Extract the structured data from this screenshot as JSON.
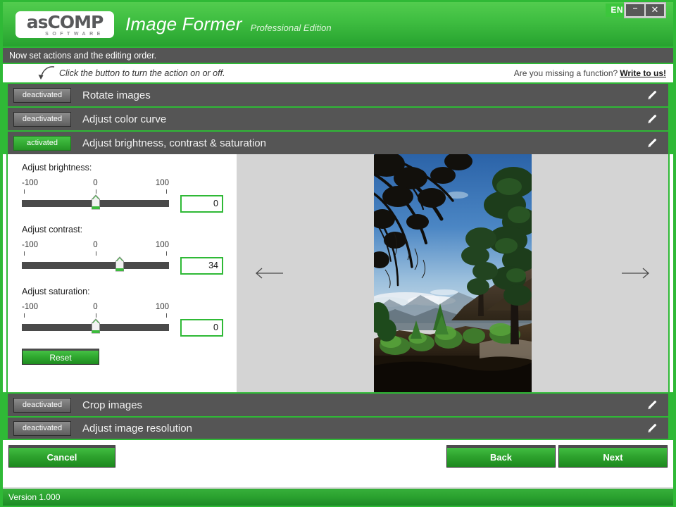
{
  "window": {
    "language_badge": "EN",
    "minimize_label": "–",
    "close_label": "✕"
  },
  "header": {
    "logo_main": "asCOMP",
    "logo_sub": "SOFTWARE",
    "app_title": "Image Former",
    "edition": "Professional Edition"
  },
  "subheader": {
    "text": "Now set actions and the editing order."
  },
  "hint": {
    "text": "Click the button to turn the action on or off.",
    "right_question": "Are you missing a function?",
    "right_link": "Write to us!"
  },
  "actions": [
    {
      "state_label": "deactivated",
      "state": "off",
      "label": "Rotate images"
    },
    {
      "state_label": "deactivated",
      "state": "off",
      "label": "Adjust color curve"
    },
    {
      "state_label": "activated",
      "state": "on",
      "label": "Adjust brightness, contrast & saturation"
    },
    {
      "state_label": "deactivated",
      "state": "off",
      "label": "Crop images"
    },
    {
      "state_label": "deactivated",
      "state": "off",
      "label": "Adjust image resolution"
    }
  ],
  "panel": {
    "sliders": [
      {
        "label": "Adjust brightness:",
        "scale_min": "-100",
        "scale_mid": "0",
        "scale_max": "100",
        "value": "0",
        "value_number": 0
      },
      {
        "label": "Adjust contrast:",
        "scale_min": "-100",
        "scale_mid": "0",
        "scale_max": "100",
        "value": "34",
        "value_number": 34
      },
      {
        "label": "Adjust saturation:",
        "scale_min": "-100",
        "scale_mid": "0",
        "scale_max": "100",
        "value": "0",
        "value_number": 0
      }
    ],
    "reset_label": "Reset",
    "prev_icon": "arrow-left-icon",
    "next_icon": "arrow-right-icon"
  },
  "buttons": {
    "cancel": "Cancel",
    "back": "Back",
    "next": "Next"
  },
  "statusbar": {
    "version": "Version 1.000"
  },
  "colors": {
    "brand_green": "#2fb936",
    "dark_row": "#555555",
    "panel_gray": "#d4d4d4",
    "track": "#4a4a4a"
  }
}
